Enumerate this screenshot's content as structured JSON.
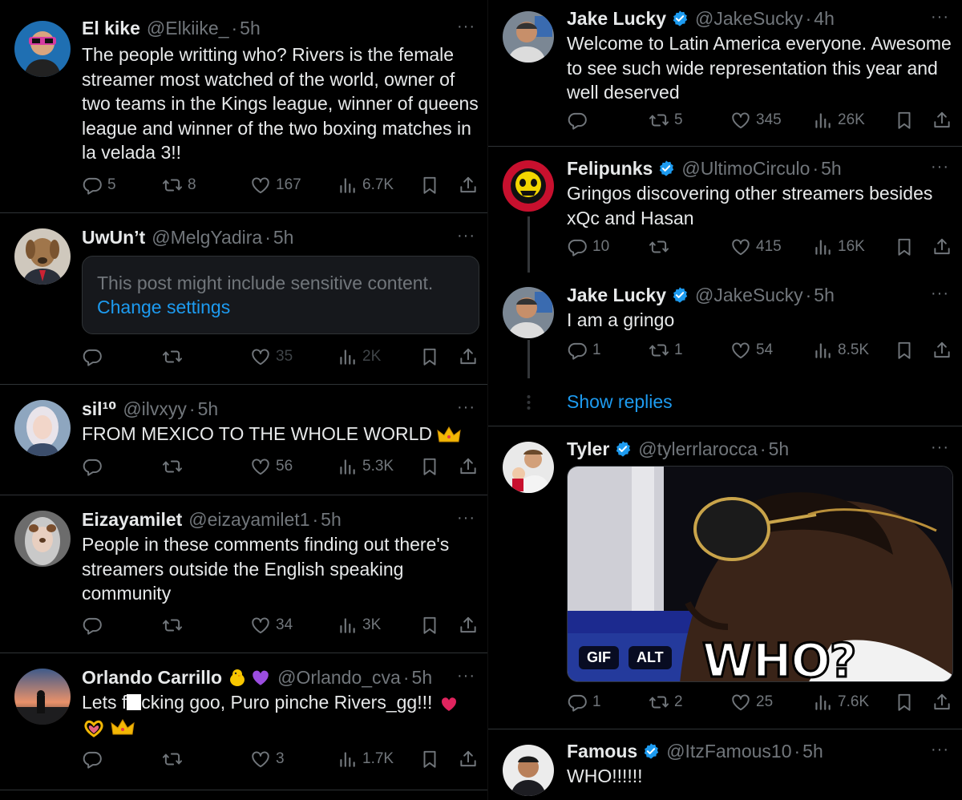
{
  "left": {
    "posts": [
      {
        "name": "El kike",
        "handle": "@Elkiike_",
        "time": "5h",
        "text": "The people writting who? Rivers is the female streamer most watched of the world, owner of two teams in the Kings league, winner of queens league and winner of the two boxing matches in la velada 3!!",
        "replies": "5",
        "reposts": "8",
        "likes": "167",
        "views": "6.7K"
      },
      {
        "name": "UwUn’t",
        "handle": "@MelgYadira",
        "time": "5h",
        "sensitive_msg": "This post might include sensitive content.",
        "sensitive_link": "Change settings",
        "replies": "",
        "reposts": "",
        "likes": "35",
        "views": "2K"
      },
      {
        "name": "sil¹⁰",
        "handle": "@ilvxyy",
        "time": "5h",
        "text": "FROM MEXICO TO THE WHOLE WORLD",
        "replies": "",
        "reposts": "",
        "likes": "56",
        "views": "5.3K"
      },
      {
        "name": "Eizayamilet",
        "handle": "@eizayamilet1",
        "time": "5h",
        "text": "People in these comments finding out there's streamers outside the English speaking community",
        "replies": "",
        "reposts": "",
        "likes": "34",
        "views": "3K"
      },
      {
        "name": "Orlando Carrillo",
        "handle": "@Orlando_cva",
        "time": "5h",
        "text_a": "Lets f",
        "text_b": "cking goo, Puro pinche Rivers_gg!!!",
        "replies": "",
        "reposts": "",
        "likes": "3",
        "views": "1.7K"
      }
    ]
  },
  "right": {
    "posts": [
      {
        "name": "Jake Lucky",
        "handle": "@JakeSucky",
        "time": "4h",
        "text": "Welcome to Latin America everyone. Awesome to see such wide representation this year and well deserved",
        "replies": "",
        "reposts": "5",
        "likes": "345",
        "views": "26K"
      },
      {
        "name": "Felipunks",
        "handle": "@UltimoCirculo",
        "time": "5h",
        "text": "Gringos discovering other streamers besides xQc and Hasan",
        "replies": "10",
        "reposts": "",
        "likes": "415",
        "views": "16K"
      },
      {
        "name": "Jake Lucky",
        "handle": "@JakeSucky",
        "time": "5h",
        "text": "I am a gringo",
        "replies": "1",
        "reposts": "1",
        "likes": "54",
        "views": "8.5K"
      },
      {
        "name": "Tyler",
        "handle": "@tylerrlarocca",
        "time": "5h",
        "gif_badge": "GIF",
        "alt_badge": "ALT",
        "gif_caption": "WHO?",
        "replies": "1",
        "reposts": "2",
        "likes": "25",
        "views": "7.6K"
      },
      {
        "name": "Famous",
        "handle": "@ItzFamous10",
        "time": "5h",
        "text": "WHO!!!!!!"
      }
    ],
    "show_replies": "Show replies"
  },
  "icons": [
    "reply-icon",
    "repost-icon",
    "like-icon",
    "views-icon",
    "bookmark-icon",
    "share-icon",
    "verified-icon",
    "more-icon"
  ],
  "colors": {
    "background": "#000000",
    "text": "#e7e9ea",
    "muted": "#71767b",
    "link": "#1d9bf0",
    "border": "#2f3336"
  },
  "common": {
    "separator": "·",
    "more": "···"
  }
}
